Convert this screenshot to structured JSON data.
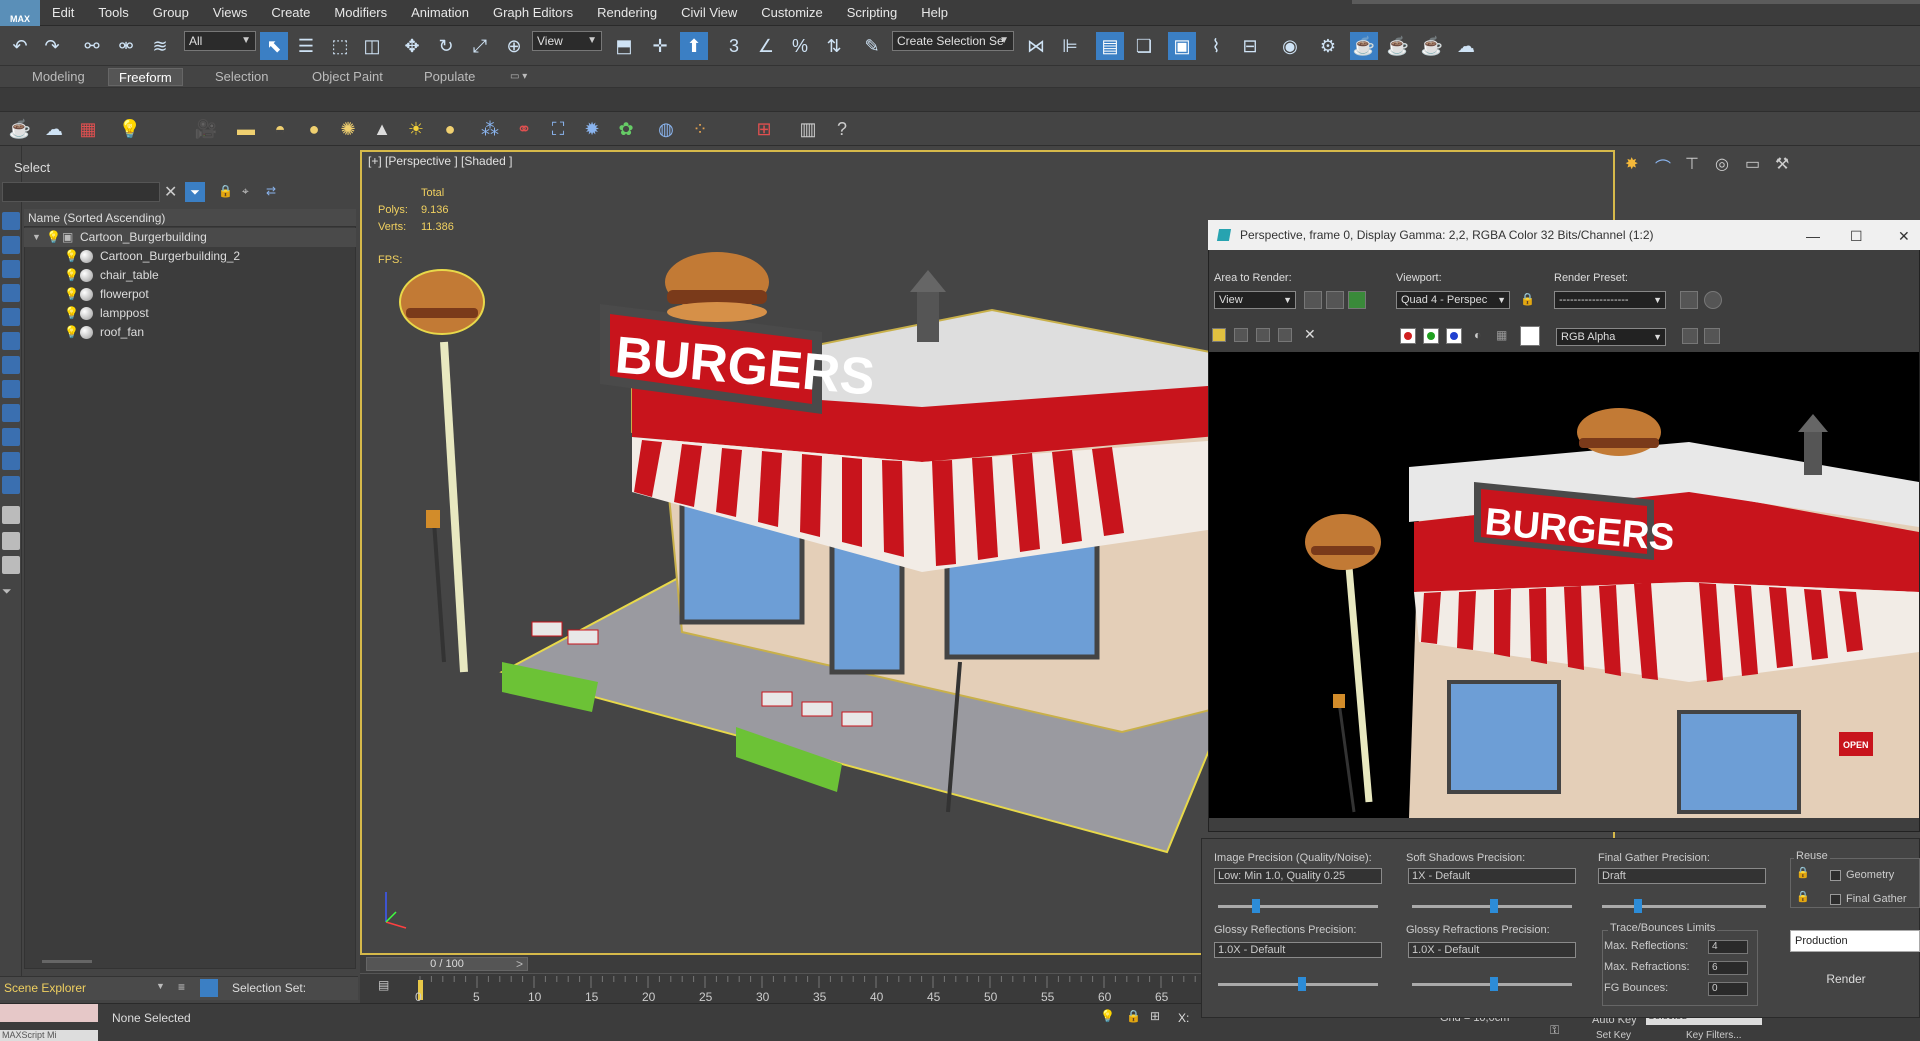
{
  "app": {
    "logo": "MAX"
  },
  "menu": [
    "Edit",
    "Tools",
    "Group",
    "Views",
    "Create",
    "Modifiers",
    "Animation",
    "Graph Editors",
    "Rendering",
    "Civil View",
    "Customize",
    "Scripting",
    "Help"
  ],
  "toolbar": {
    "selection_filter": "All",
    "ref_coord": "View",
    "named_selection": "Create Selection Se"
  },
  "ribbon": {
    "tabs": [
      "Modeling",
      "Freeform",
      "Selection",
      "Object Paint",
      "Populate"
    ],
    "active": "Freeform"
  },
  "explorer": {
    "title": "Select",
    "column_header": "Name (Sorted Ascending)",
    "root": "Cartoon_Burgerbuilding",
    "children": [
      "Cartoon_Burgerbuilding_2",
      "chair_table",
      "flowerpot",
      "lamppost",
      "roof_fan"
    ],
    "footer_label": "Scene Explorer",
    "selection_set_label": "Selection Set:"
  },
  "viewport": {
    "label": "[+] [Perspective ] [Shaded ]",
    "stats_total": "Total",
    "polys_label": "Polys:",
    "polys_value": "9.136",
    "verts_label": "Verts:",
    "verts_value": "11.386",
    "fps_label": "FPS:",
    "sign_text": "BURGERS"
  },
  "timeline": {
    "frame": "0 / 100",
    "ticks": [
      "0",
      "5",
      "10",
      "15",
      "20",
      "25",
      "30",
      "35",
      "40",
      "45",
      "50",
      "55",
      "60",
      "65"
    ]
  },
  "status": {
    "maxscript": "MAXScript Mi",
    "text": "None Selected",
    "x_label": "X:",
    "grid": "Grid = 10,0cm",
    "autokey": "Auto Key",
    "selected": "Selected",
    "setkey": "Set Key",
    "keyfilters": "Key Filters..."
  },
  "render_window": {
    "title": "Perspective, frame 0, Display Gamma: 2,2, RGBA Color 32 Bits/Channel (1:2)",
    "area_label": "Area to Render:",
    "area_value": "View",
    "viewport_label": "Viewport:",
    "viewport_value": "Quad 4 - Perspec",
    "preset_label": "Render Preset:",
    "preset_value": "-------------------",
    "channel_value": "RGB Alpha",
    "sign_text": "BURGERS",
    "open_sign": "OPEN",
    "image_precision_label": "Image Precision (Quality/Noise):",
    "image_precision_value": "Low: Min 1.0, Quality 0.25",
    "soft_shadows_label": "Soft Shadows Precision:",
    "soft_shadows_value": "1X - Default",
    "final_gather_label": "Final Gather Precision:",
    "final_gather_value": "Draft",
    "glossy_refl_label": "Glossy Reflections Precision:",
    "glossy_refl_value": "1.0X - Default",
    "glossy_refr_label": "Glossy Refractions Precision:",
    "glossy_refr_value": "1.0X - Default",
    "reuse_label": "Reuse",
    "geometry_label": "Geometry",
    "final_gather_check": "Final Gather",
    "trace_label": "Trace/Bounces Limits",
    "max_refl_label": "Max. Reflections:",
    "max_refl_value": "4",
    "max_refr_label": "Max. Refractions:",
    "max_refr_value": "6",
    "fg_bounces_label": "FG Bounces:",
    "fg_bounces_value": "0",
    "production_value": "Production",
    "render_button": "Render"
  }
}
